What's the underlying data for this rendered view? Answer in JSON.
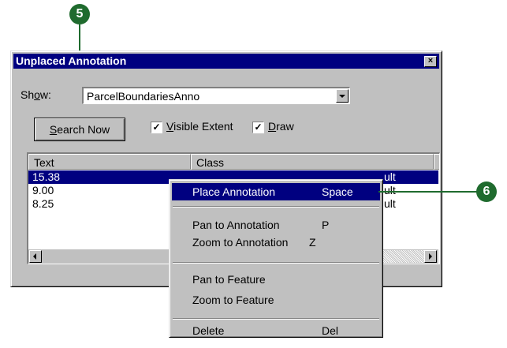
{
  "callouts": {
    "step5": "5",
    "step6": "6"
  },
  "dialog": {
    "title": "Unplaced Annotation",
    "close_glyph": "×",
    "show_label_pre": "Sh",
    "show_label_u": "o",
    "show_label_post": "w:",
    "show_value": "ParcelBoundariesAnno",
    "search_button_u": "S",
    "search_button_rest": "earch Now",
    "visible_extent_u": "V",
    "visible_extent_rest": "isible Extent",
    "visible_extent_checked": true,
    "draw_u": "D",
    "draw_rest": "raw",
    "draw_checked": true,
    "check_glyph": "✓",
    "columns": [
      "Text",
      "Class"
    ],
    "rows": [
      {
        "text": "15.38",
        "class_fragment": "ult"
      },
      {
        "text": "9.00",
        "class_fragment": "ult"
      },
      {
        "text": "8.25",
        "class_fragment": "ult"
      }
    ]
  },
  "context_menu": {
    "items": [
      {
        "label": "Place Annotation",
        "shortcut": "Space"
      },
      {
        "label": "Pan to Annotation",
        "shortcut": "P"
      },
      {
        "label": "Zoom to Annotation",
        "shortcut": "Z"
      },
      {
        "label": "Pan to Feature",
        "shortcut": ""
      },
      {
        "label": "Zoom to Feature",
        "shortcut": ""
      },
      {
        "label": "Delete",
        "shortcut": "Del"
      }
    ]
  },
  "colors": {
    "titlebar": "#000080",
    "callout": "#1f6b2e",
    "face": "#c0c0c0"
  }
}
